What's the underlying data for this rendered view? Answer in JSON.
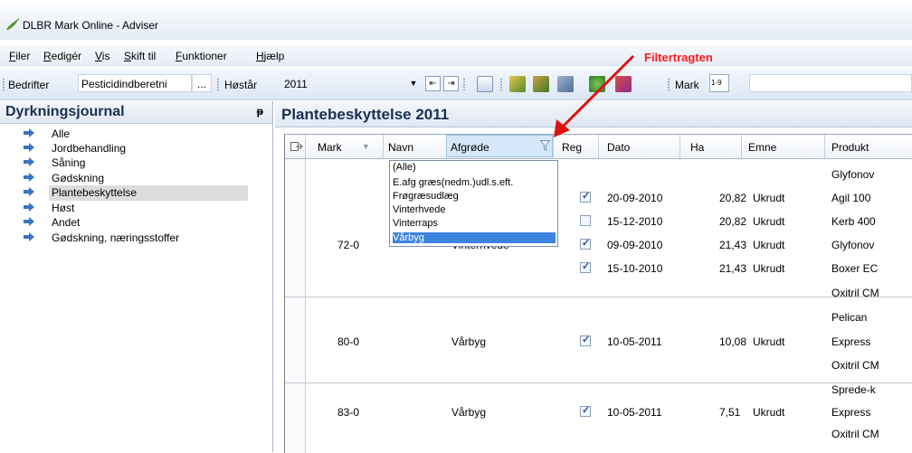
{
  "window": {
    "title": "DLBR Mark Online - Adviser"
  },
  "menu": [
    {
      "label": "Filer"
    },
    {
      "label": "Redigér"
    },
    {
      "label": "Vis"
    },
    {
      "label": "Skift til"
    },
    {
      "label": "Funktioner"
    },
    {
      "label": "Hjælp"
    }
  ],
  "toolbar": {
    "bedrifter_label": "Bedrifter",
    "bedrifter_value": "Pesticidindberetni",
    "bedrifter_more": "...",
    "hoestaar_label": "Høstår",
    "hoestaar_value": "2011",
    "mark_label": "Mark",
    "mark_icon_text": "1-9"
  },
  "annotation": {
    "text": "Filtertragten",
    "color": "#ff1a1a"
  },
  "left_panel": {
    "title": "Dyrkningsjournal",
    "pin_glyph": "ᵽ",
    "items": [
      {
        "label": "Alle"
      },
      {
        "label": "Jordbehandling"
      },
      {
        "label": "Såning"
      },
      {
        "label": "Gødskning"
      },
      {
        "label": "Plantebeskyttelse"
      },
      {
        "label": "Høst"
      },
      {
        "label": "Andet"
      },
      {
        "label": "Gødskning, næringsstoffer"
      }
    ],
    "selected_index": 4
  },
  "right_panel": {
    "title": "Plantebeskyttelse 2011",
    "columns": {
      "mark": "Mark",
      "navn": "Navn",
      "afgroede": "Afgrøde",
      "reg": "Reg",
      "dato": "Dato",
      "ha": "Ha",
      "emne": "Emne",
      "produkt": "Produkt"
    },
    "rows": [
      {
        "mark": "",
        "afgroede": "",
        "reg": null,
        "dato": "",
        "ha": "",
        "emne": "",
        "produkt": "Glyfonov"
      },
      {
        "mark": "",
        "afgroede": "",
        "reg": true,
        "dato": "20-09-2010",
        "ha": "20,82",
        "emne": "Ukrudt",
        "produkt": "Agil 100"
      },
      {
        "mark": "",
        "afgroede": "",
        "reg": false,
        "dato": "15-12-2010",
        "ha": "20,82",
        "emne": "Ukrudt",
        "produkt": "Kerb 400"
      },
      {
        "mark": "72-0",
        "afgroede": "Vinterhvede",
        "reg": true,
        "dato": "09-09-2010",
        "ha": "21,43",
        "emne": "Ukrudt",
        "produkt": "Glyfonov"
      },
      {
        "mark": "",
        "afgroede": "",
        "reg": true,
        "dato": "15-10-2010",
        "ha": "21,43",
        "emne": "Ukrudt",
        "produkt": "Boxer EC"
      },
      {
        "mark": "",
        "afgroede": "",
        "reg": null,
        "dato": "",
        "ha": "",
        "emne": "",
        "produkt": "Oxitril CM"
      },
      {
        "mark": "",
        "afgroede": "",
        "reg": null,
        "dato": "",
        "ha": "",
        "emne": "",
        "produkt": "Pelican"
      },
      {
        "mark": "80-0",
        "afgroede": "Vårbyg",
        "reg": true,
        "dato": "10-05-2011",
        "ha": "10,08",
        "emne": "Ukrudt",
        "produkt": "Express"
      },
      {
        "mark": "",
        "afgroede": "",
        "reg": null,
        "dato": "",
        "ha": "",
        "emne": "",
        "produkt": "Oxitril CM"
      },
      {
        "mark": "",
        "afgroede": "",
        "reg": null,
        "dato": "",
        "ha": "",
        "emne": "",
        "produkt": "Sprede-k"
      },
      {
        "mark": "83-0",
        "afgroede": "Vårbyg",
        "reg": true,
        "dato": "10-05-2011",
        "ha": "7,51",
        "emne": "Ukrudt",
        "produkt": "Express"
      },
      {
        "mark": "",
        "afgroede": "",
        "reg": null,
        "dato": "",
        "ha": "",
        "emne": "",
        "produkt": "Oxitril CM"
      }
    ],
    "filter_options": [
      {
        "label": "(Alle)"
      },
      {
        "label": "E.afg græs(nedm.)udl.s.eft."
      },
      {
        "label": "Frøgræsudlæg"
      },
      {
        "label": "Vinterhvede"
      },
      {
        "label": "Vinterraps"
      },
      {
        "label": "Vårbyg"
      }
    ],
    "filter_selected_index": 5
  }
}
